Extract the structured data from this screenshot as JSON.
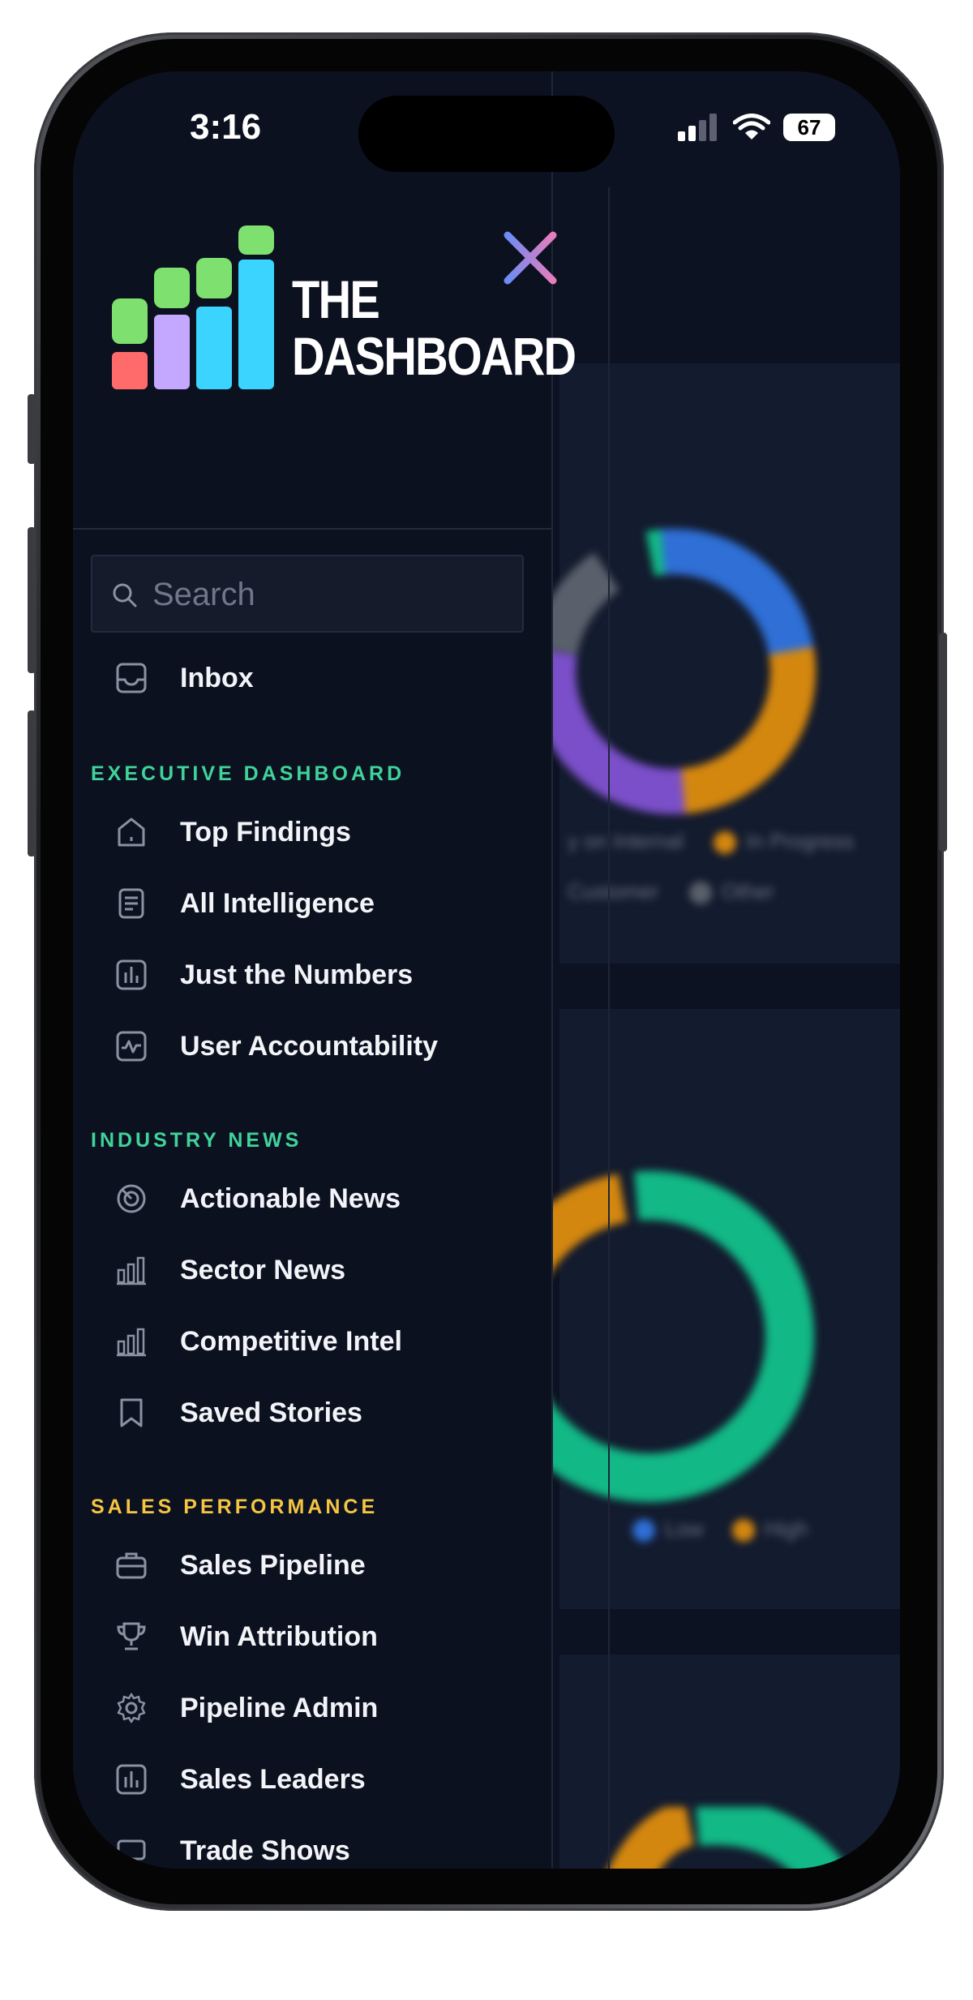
{
  "status_bar": {
    "time": "3:16",
    "battery": "67"
  },
  "brand": {
    "line1": "THE",
    "line2": "DASHBOARD"
  },
  "search": {
    "placeholder": "Search",
    "value": ""
  },
  "inbox": {
    "label": "Inbox"
  },
  "sections": [
    {
      "title": "EXECUTIVE DASHBOARD",
      "color": "#3fd39a",
      "items": [
        {
          "label": "Top Findings",
          "icon": "home-icon"
        },
        {
          "label": "All Intelligence",
          "icon": "document-icon"
        },
        {
          "label": "Just the Numbers",
          "icon": "bar-chart-icon"
        },
        {
          "label": "User Accountability",
          "icon": "activity-icon"
        }
      ]
    },
    {
      "title": "INDUSTRY NEWS",
      "color": "#3fd39a",
      "items": [
        {
          "label": "Actionable News",
          "icon": "radar-icon"
        },
        {
          "label": "Sector News",
          "icon": "bars-icon"
        },
        {
          "label": "Competitive Intel",
          "icon": "bars-icon"
        },
        {
          "label": "Saved Stories",
          "icon": "bookmark-icon"
        }
      ]
    },
    {
      "title": "SALES PERFORMANCE",
      "color": "#f5c542",
      "items": [
        {
          "label": "Sales Pipeline",
          "icon": "briefcase-icon"
        },
        {
          "label": "Win Attribution",
          "icon": "trophy-icon"
        },
        {
          "label": "Pipeline Admin",
          "icon": "gear-icon"
        },
        {
          "label": "Sales Leaders",
          "icon": "bar-chart-icon"
        },
        {
          "label": "Trade Shows",
          "icon": "trade-show-icon"
        }
      ]
    }
  ],
  "background": {
    "legend1": [
      "y on Internal",
      "In Progress",
      "Customer",
      "Other"
    ],
    "legend2": [
      "Low",
      "High"
    ],
    "colors": {
      "blue": "#2f6fd6",
      "orange": "#d4870f",
      "purple": "#7b4fc9",
      "green": "#12b886",
      "gray": "#5a606b"
    }
  }
}
